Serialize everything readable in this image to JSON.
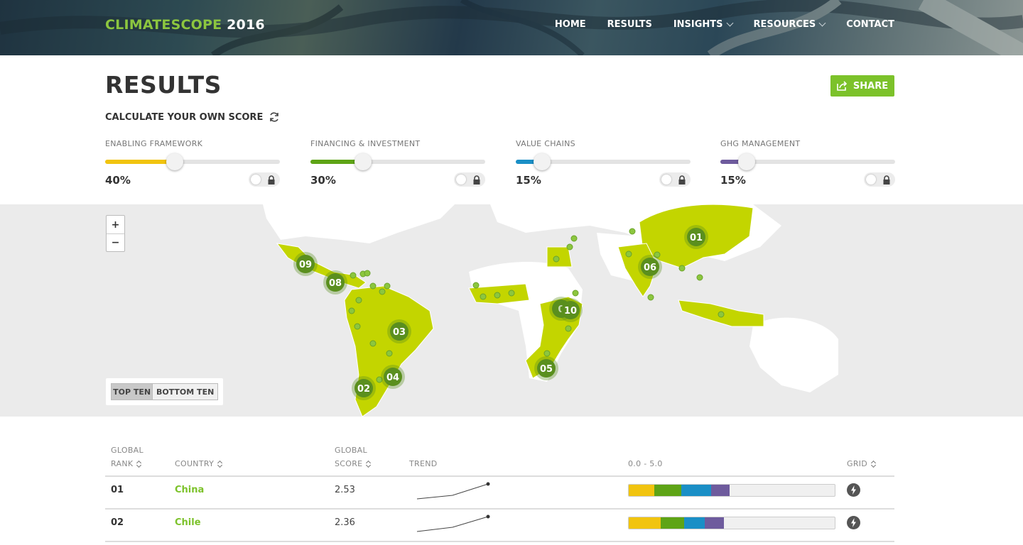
{
  "header": {
    "logo_part1": "CLIMATESCOPE",
    "logo_part2": "2016",
    "nav": [
      {
        "label": "HOME",
        "dropdown": false
      },
      {
        "label": "RESULTS",
        "dropdown": false
      },
      {
        "label": "INSIGHTS",
        "dropdown": true
      },
      {
        "label": "RESOURCES",
        "dropdown": true
      },
      {
        "label": "CONTACT",
        "dropdown": false
      }
    ]
  },
  "results": {
    "title": "RESULTS",
    "share_label": "SHARE",
    "calculate_label": "CALCULATE YOUR OWN SCORE",
    "sliders": [
      {
        "label": "ENABLING FRAMEWORK",
        "value": "40%",
        "fraction": 0.4,
        "color": "#f1c40f"
      },
      {
        "label": "FINANCING & INVESTMENT",
        "value": "30%",
        "fraction": 0.3,
        "color": "#5ea416"
      },
      {
        "label": "VALUE CHAINS",
        "value": "15%",
        "fraction": 0.15,
        "color": "#1a8fc6"
      },
      {
        "label": "GHG MANAGEMENT",
        "value": "15%",
        "fraction": 0.15,
        "color": "#6e5b9d"
      }
    ]
  },
  "map": {
    "zoom_in": "+",
    "zoom_out": "−",
    "toggle_top": "TOP TEN",
    "toggle_bottom": "BOTTOM TEN",
    "markers": [
      "01",
      "06",
      "09",
      "08",
      "03",
      "04",
      "02",
      "0",
      "10",
      "05"
    ]
  },
  "table": {
    "col_rank_1": "GLOBAL",
    "col_rank_2": "RANK",
    "col_country": "COUNTRY",
    "col_score_1": "GLOBAL",
    "col_score_2": "SCORE",
    "col_trend": "TREND",
    "col_range": "0.0 - 5.0",
    "col_grid": "GRID",
    "rows": [
      {
        "rank": "01",
        "country": "China",
        "score": "2.53",
        "segments": [
          0.62,
          0.65,
          0.73,
          0.45
        ]
      },
      {
        "rank": "02",
        "country": "Chile",
        "score": "2.36",
        "segments": [
          0.78,
          0.57,
          0.5,
          0.46
        ]
      }
    ]
  },
  "colors": {
    "accent_green": "#7cc22a",
    "map_land": "#c3d500",
    "marker": "#5a8f1e"
  }
}
